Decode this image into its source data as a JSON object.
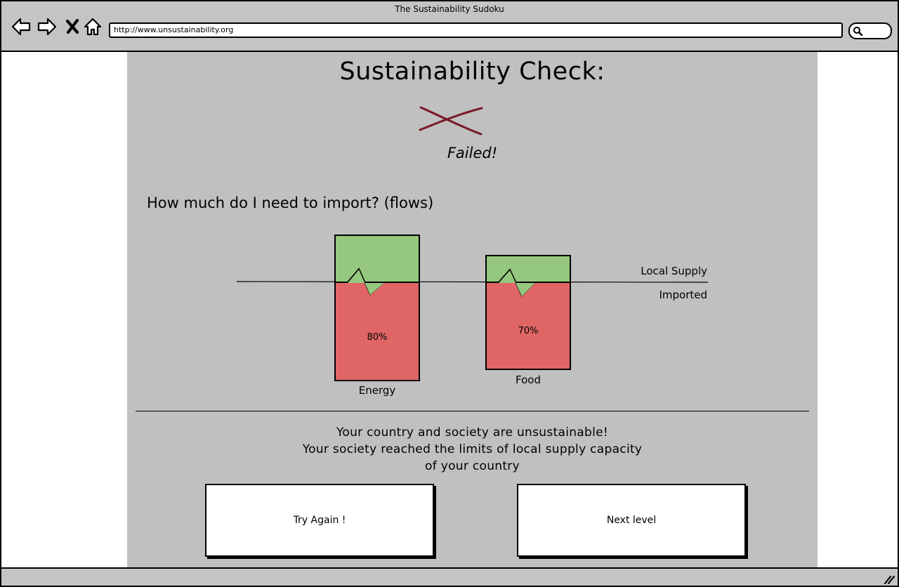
{
  "window": {
    "title": "The Sustainability Sudoku",
    "url": "http://www.unsustainability.org"
  },
  "icons": {
    "back": "back-arrow-icon",
    "forward": "forward-arrow-icon",
    "stop": "close-icon",
    "home": "home-icon",
    "search": "search-icon",
    "fail": "cross-icon"
  },
  "page": {
    "title": "Sustainability Check:",
    "result": "Failed!",
    "question": "How much do I need to import? (flows)",
    "message_lines": [
      "Your country and society are unsustainable!",
      "Your society reached the limits of local supply capacity",
      "of your country"
    ],
    "buttons": {
      "try_again": "Try Again !",
      "next_level": "Next level"
    }
  },
  "legend": {
    "local": "Local Supply",
    "imported": "Imported"
  },
  "colors": {
    "local_supply": "#95c77e",
    "imported": "#e06666",
    "fail_mark": "#7a1a2a",
    "content_bg": "#c0c0c0"
  },
  "chart_data": {
    "type": "bar",
    "categories": [
      "Energy",
      "Food"
    ],
    "series": [
      {
        "name": "Imported",
        "values": [
          80,
          70
        ]
      },
      {
        "name": "Local Supply",
        "values": [
          20,
          30
        ]
      }
    ],
    "labels": [
      "80%",
      "70%"
    ]
  }
}
